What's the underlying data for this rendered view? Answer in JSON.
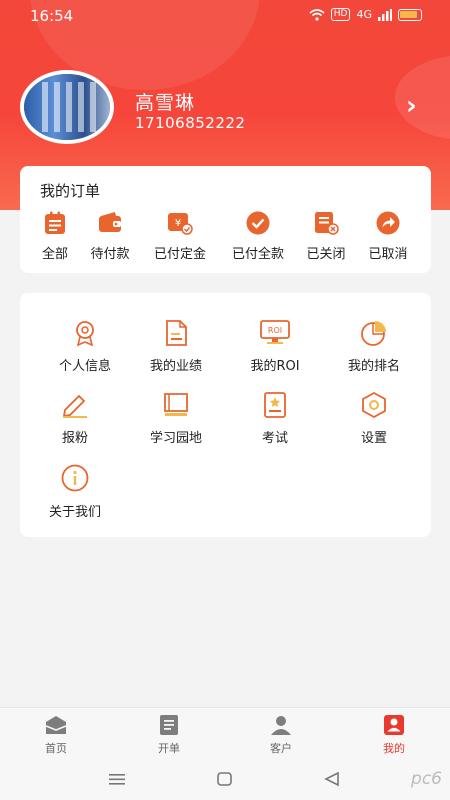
{
  "status_bar": {
    "time": "16:54",
    "signal_text": "4G",
    "hd_label": "HD"
  },
  "profile": {
    "name": "高雪琳",
    "phone": "17106852222"
  },
  "orders": {
    "title": "我的订单",
    "items": [
      {
        "label": "全部",
        "icon": "clipboard-icon"
      },
      {
        "label": "待付款",
        "icon": "wallet-icon"
      },
      {
        "label": "已付定金",
        "icon": "deposit-icon"
      },
      {
        "label": "已付全款",
        "icon": "check-circle-icon"
      },
      {
        "label": "已关闭",
        "icon": "closed-order-icon"
      },
      {
        "label": "已取消",
        "icon": "cancel-share-icon"
      }
    ]
  },
  "menu": {
    "items": [
      {
        "label": "个人信息",
        "icon": "person-badge-icon"
      },
      {
        "label": "我的业绩",
        "icon": "document-icon"
      },
      {
        "label": "我的ROI",
        "icon": "roi-monitor-icon"
      },
      {
        "label": "我的排名",
        "icon": "pie-chart-icon"
      },
      {
        "label": "报粉",
        "icon": "pen-icon"
      },
      {
        "label": "学习园地",
        "icon": "book-icon"
      },
      {
        "label": "考试",
        "icon": "exam-icon"
      },
      {
        "label": "设置",
        "icon": "settings-hexagon-icon"
      },
      {
        "label": "关于我们",
        "icon": "info-icon"
      }
    ]
  },
  "tabbar": {
    "tabs": [
      {
        "label": "首页",
        "icon": "home-icon",
        "active": false
      },
      {
        "label": "开单",
        "icon": "order-form-icon",
        "active": false
      },
      {
        "label": "客户",
        "icon": "customer-icon",
        "active": false
      },
      {
        "label": "我的",
        "icon": "mine-icon",
        "active": true
      }
    ]
  },
  "watermark": "pc6",
  "colors": {
    "accent": "#f2473a",
    "icon_orange": "#e8652e",
    "active_tab": "#e8392f"
  }
}
